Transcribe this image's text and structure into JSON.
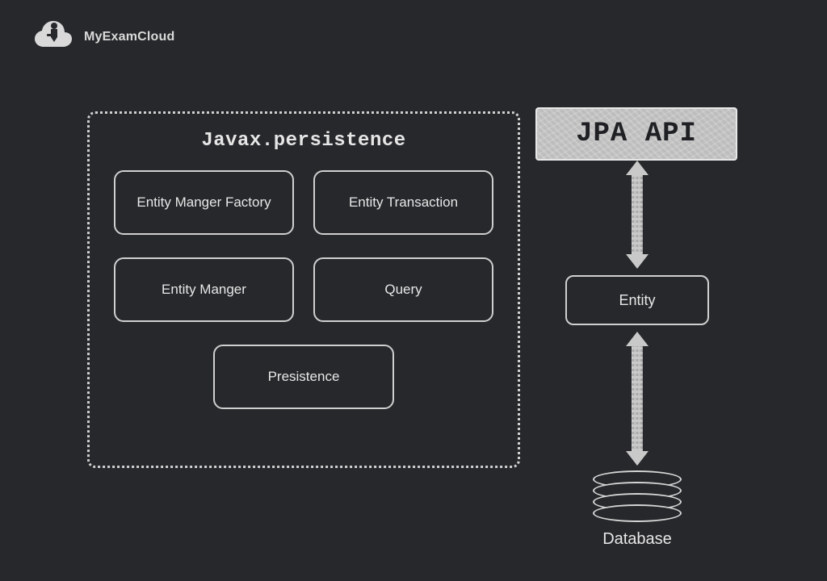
{
  "logo": {
    "brand": "MyExamCloud"
  },
  "main_box": {
    "title": "Javax.persistence",
    "components": {
      "r1c1": "Entity Manger Factory",
      "r1c2": "Entity Transaction",
      "r2c1": "Entity Manger",
      "r2c2": "Query",
      "r3": "Presistence"
    }
  },
  "badge": {
    "label": "JPA API"
  },
  "right": {
    "entity_label": "Entity",
    "db_label": "Database"
  }
}
